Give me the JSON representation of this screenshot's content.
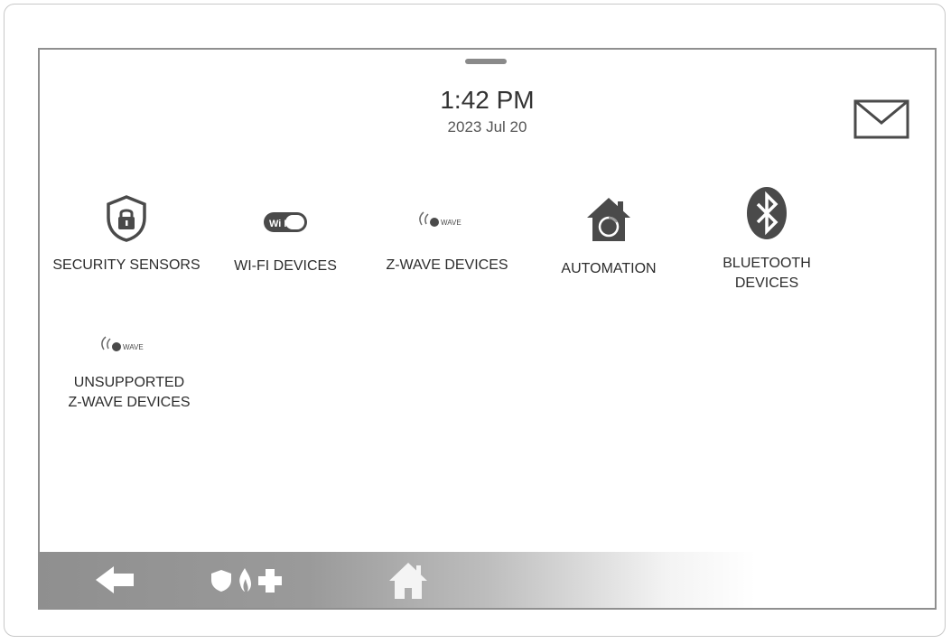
{
  "clock": {
    "time": "1:42 PM",
    "date": "2023 Jul 20"
  },
  "tiles": [
    {
      "label": "SECURITY SENSORS",
      "icon": "shield-lock-icon"
    },
    {
      "label": "WI-FI DEVICES",
      "icon": "wifi-icon"
    },
    {
      "label": "Z-WAVE DEVICES",
      "icon": "zwave-icon",
      "icon_text": "WAVE"
    },
    {
      "label": "AUTOMATION",
      "icon": "house-automation-icon"
    },
    {
      "label_line1": "BLUETOOTH",
      "label_line2": "DEVICES",
      "icon": "bluetooth-icon"
    },
    {
      "label_line1": "UNSUPPORTED",
      "label_line2": "Z-WAVE DEVICES",
      "icon": "zwave-icon",
      "icon_text": "WAVE"
    }
  ],
  "wifi_icon_text": "Wi Fi",
  "navbar": {
    "items": [
      "back-arrow-icon",
      "shield-icon",
      "fire-icon",
      "medical-cross-icon",
      "home-icon"
    ]
  },
  "colors": {
    "icon": "#4a4a4a",
    "text": "#2c2c2c",
    "border": "#8f8f8f"
  }
}
